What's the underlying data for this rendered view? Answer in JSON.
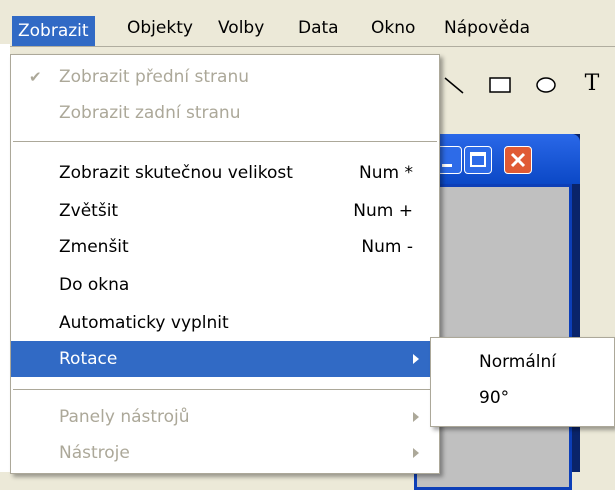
{
  "menubar": {
    "items": [
      "Zobrazit",
      "Objekty",
      "Volby",
      "Data",
      "Okno",
      "Nápověda"
    ],
    "active_index": 0
  },
  "toolbar": {
    "tools": [
      "line-icon",
      "rectangle-icon",
      "ellipse-icon",
      "text-icon"
    ],
    "text_tool_label": "T"
  },
  "menu": {
    "items": [
      {
        "label": "Zobrazit přední stranu",
        "shortcut": "",
        "checked": true,
        "disabled": true
      },
      {
        "label": "Zobrazit zadní stranu",
        "shortcut": "",
        "disabled": true
      },
      {
        "label": "Zobrazit skutečnou velikost",
        "shortcut": "Num *"
      },
      {
        "label": "Zvětšit",
        "shortcut": "Num +"
      },
      {
        "label": "Zmenšit",
        "shortcut": "Num -"
      },
      {
        "label": "Do okna",
        "shortcut": ""
      },
      {
        "label": "Automaticky vyplnit",
        "shortcut": ""
      },
      {
        "label": "Rotace",
        "shortcut": "",
        "submenu": true,
        "highlighted": true
      },
      {
        "label": "Panely nástrojů",
        "shortcut": "",
        "submenu": true,
        "disabled": true
      },
      {
        "label": "Nástroje",
        "shortcut": "",
        "submenu": true,
        "disabled": true
      }
    ]
  },
  "submenu": {
    "items": [
      "Normální",
      "90°"
    ]
  },
  "colors": {
    "highlight": "#316ac5",
    "disabled_text": "#aca899",
    "window_title": "#0b48c6",
    "close_button": "#e05a34"
  }
}
